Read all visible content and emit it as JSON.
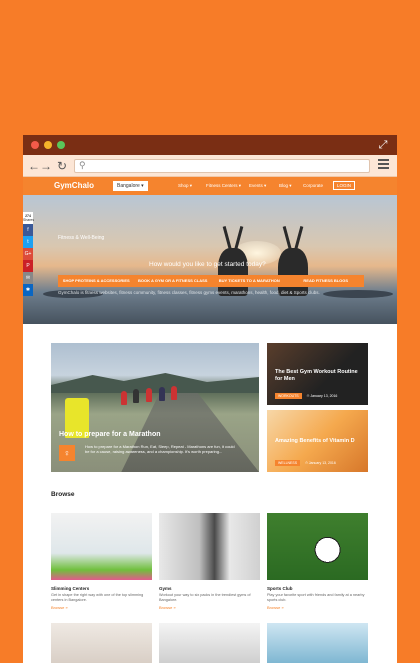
{
  "browser": {
    "url": ""
  },
  "site": {
    "logo": "GymChalo",
    "city": "Bangalore ▾",
    "nav": [
      "Shop ▾",
      "Fitness Centers ▾",
      "Events ▾",
      "Blog ▾",
      "Corporate"
    ],
    "login": "LOGIN"
  },
  "hero": {
    "tag": "Fitness & Well-Being",
    "question": "How would you like to get started today?",
    "buttons": [
      "SHOP PROTEINS & ACCESSORIES",
      "BOOK A GYM OR A FITNESS CLASS",
      "BUY TICKETS TO A MARATHON",
      "READ FITNESS BLOGS"
    ],
    "description": "GymChalo is fitness websites, fitness community, fitness classes, fitness gyms events, marathons, health, food, diet & Sports clubs."
  },
  "share": {
    "count": "274",
    "label": "Shares",
    "buttons": [
      {
        "icon": "f",
        "color": "#3b5998",
        "name": "facebook-icon"
      },
      {
        "icon": "t",
        "color": "#1da1f2",
        "name": "twitter-icon"
      },
      {
        "icon": "G+",
        "color": "#dd4b39",
        "name": "google-plus-icon"
      },
      {
        "icon": "P",
        "color": "#cb2027",
        "name": "pinterest-icon"
      },
      {
        "icon": "✉",
        "color": "#888888",
        "name": "email-icon"
      },
      {
        "icon": "✱",
        "color": "#0a66c2",
        "name": "more-share-icon"
      }
    ]
  },
  "featured": {
    "title": "How to prepare for a Marathon",
    "description": "How to prepare for a Marathon Run, Eat, Sleep, Repeat - Marathons are fun, it could be for a cause, raising awareness, and a championship. It's worth preparing..."
  },
  "side_articles": [
    {
      "title": "The Best Gym Workout Routine for Men",
      "badge": "WORKOUTS",
      "date": "⏱ January 13, 2016"
    },
    {
      "title": "Amazing Benefits of Vitamin D",
      "badge": "WELLNESS",
      "date": "⏱ January 13, 2016"
    }
  ],
  "browse": {
    "heading": "Browse",
    "tiles": [
      {
        "name": "Slimming Centers",
        "desc": "Get in shape the right way with one of the top slimming centers in Bangalore.",
        "more": "Browse »"
      },
      {
        "name": "Gyms",
        "desc": "Workout your way to six packs in the trendiest gyms of Bangalore.",
        "more": "Browse »"
      },
      {
        "name": "Sports Club",
        "desc": "Play your favorite sport with friends and family at a nearby sports club.",
        "more": "Browse »"
      }
    ]
  }
}
